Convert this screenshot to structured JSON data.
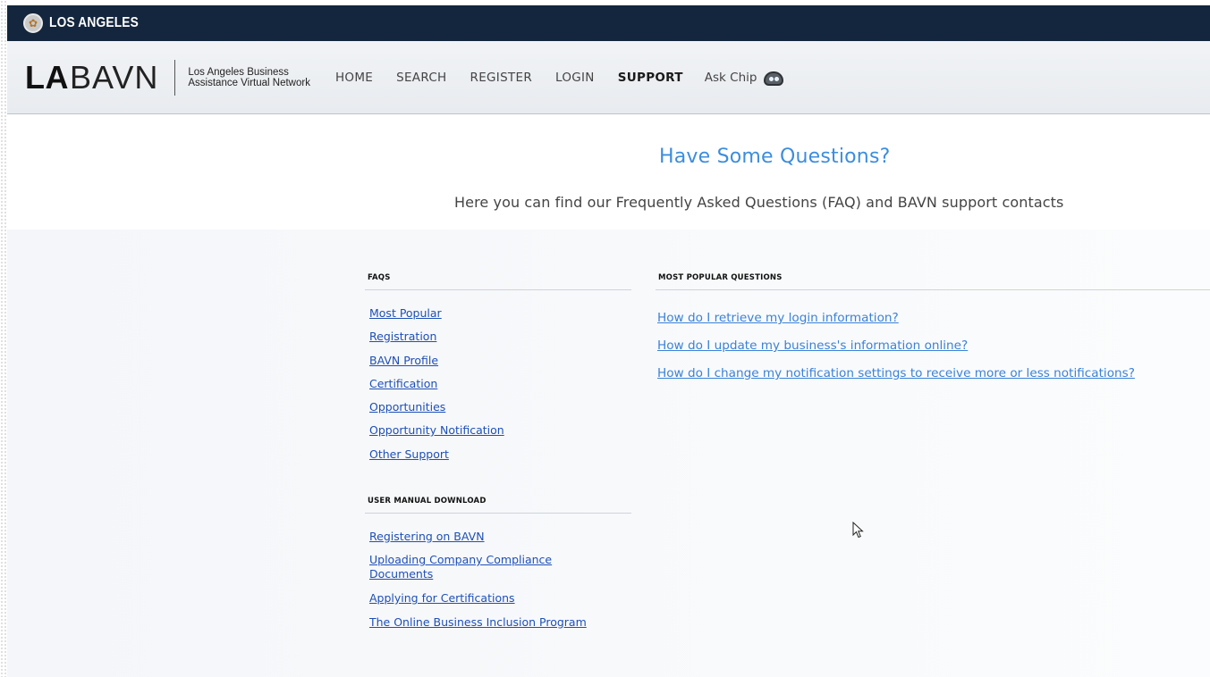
{
  "header": {
    "city": "LOS ANGELES",
    "logo_bold": "LA",
    "logo_light": "BAVN",
    "logo_subtitle_line1": "Los Angeles Business",
    "logo_subtitle_line2": "Assistance Virtual Network"
  },
  "nav": {
    "home": "HOME",
    "search": "SEARCH",
    "register": "REGISTER",
    "login": "LOGIN",
    "support": "SUPPORT",
    "ask_chip": "Ask Chip"
  },
  "hero": {
    "title": "Have Some Questions?",
    "subtitle": "Here you can find our Frequently Asked Questions (FAQ) and BAVN support contacts"
  },
  "faqs": {
    "heading": "FAQS",
    "items": [
      "Most Popular",
      "Registration",
      "BAVN Profile",
      "Certification",
      "Opportunities",
      "Opportunity Notification",
      "Other Support"
    ]
  },
  "manual": {
    "heading": "USER MANUAL DOWNLOAD",
    "items": [
      "Registering on BAVN",
      "Uploading Company Compliance Documents",
      "Applying for Certifications",
      "The Online Business Inclusion Program"
    ]
  },
  "popular": {
    "heading": "MOST POPULAR QUESTIONS",
    "items": [
      "How do I retrieve my login information?",
      "How do I update my business's information online?",
      "How do I change my notification settings to receive more or less notifications?"
    ]
  },
  "colors": {
    "topbar": "#13263d",
    "title_blue": "#3c8dde",
    "link_blue": "#1f4fb6"
  }
}
